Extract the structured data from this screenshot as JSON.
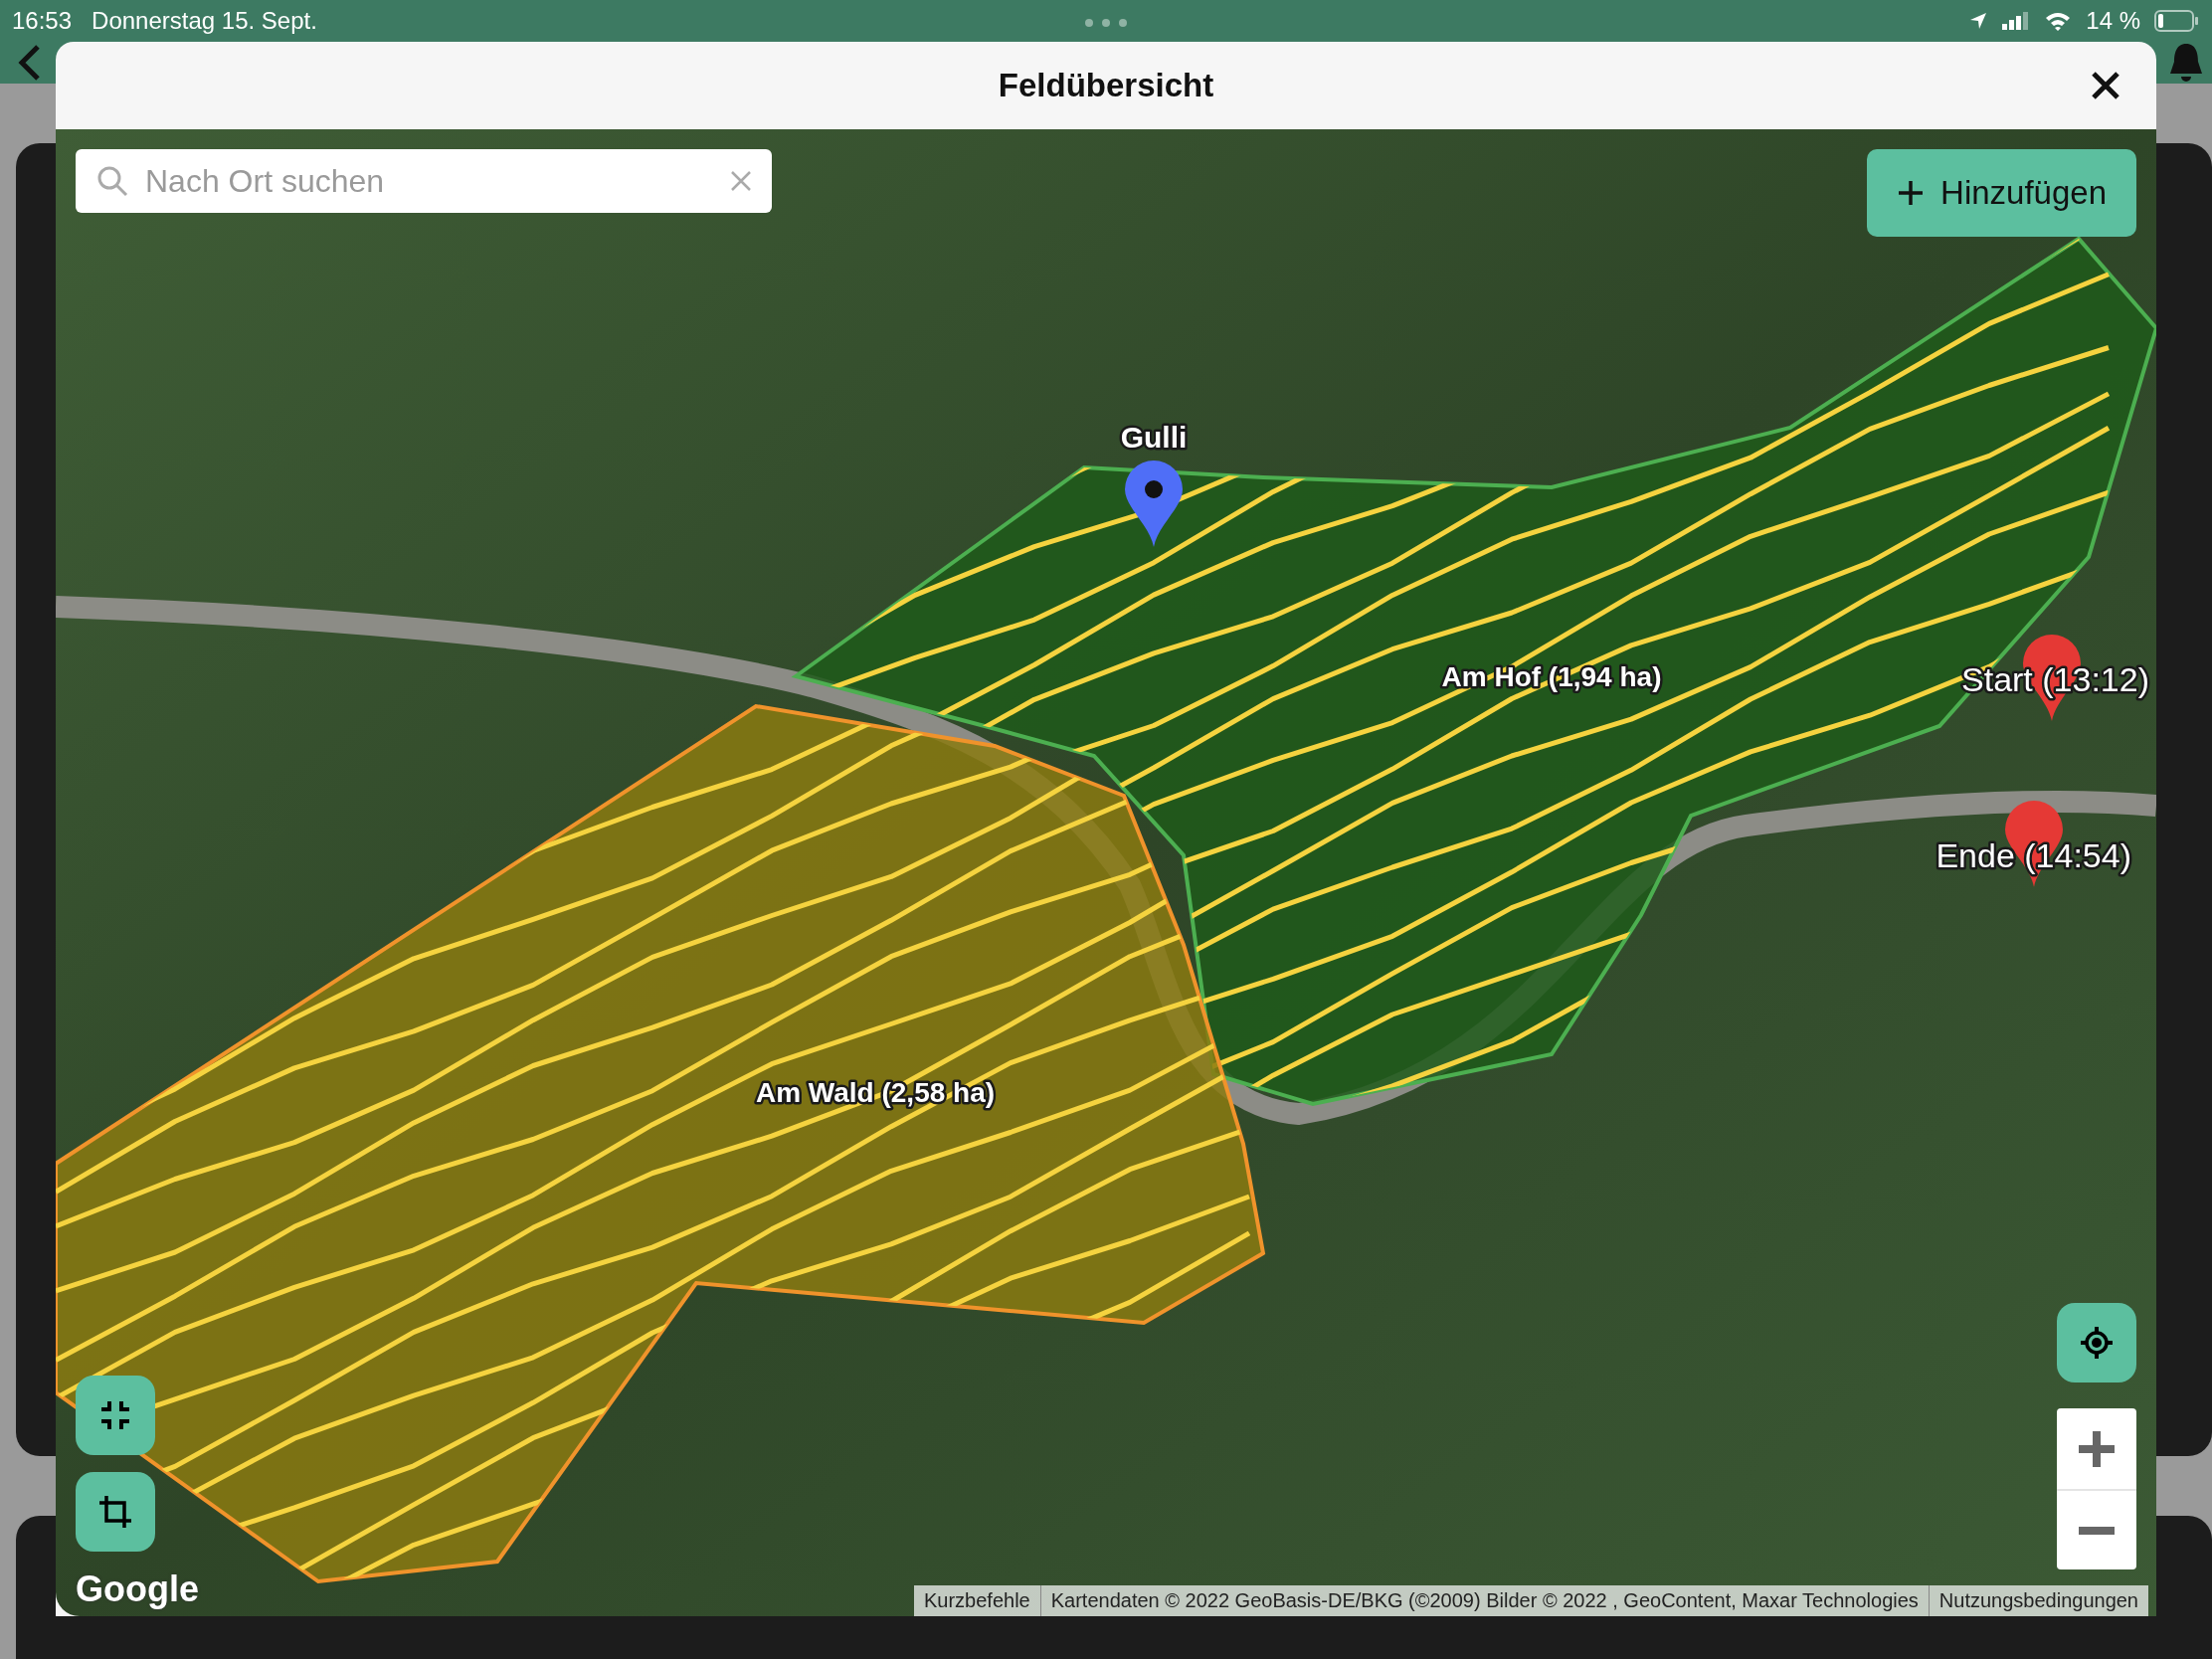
{
  "status_bar": {
    "time": "16:53",
    "date": "Donnerstag 15. Sept.",
    "battery": "14 %"
  },
  "dialog": {
    "title": "Feldübersicht"
  },
  "search": {
    "placeholder": "Nach Ort suchen"
  },
  "add_button": {
    "label": "Hinzufügen"
  },
  "fields": [
    {
      "name": "Am Hof (1,94 ha)",
      "color": "#4caf50"
    },
    {
      "name": "Am Wald (2,58 ha)",
      "color": "#f0932b"
    }
  ],
  "markers": [
    {
      "label": "Gulli",
      "kind": "poi"
    },
    {
      "label": "Start (13:12)",
      "kind": "start"
    },
    {
      "label": "Ende (14:54)",
      "kind": "end"
    }
  ],
  "map_attribution": {
    "logo": "Google",
    "links": [
      "Kurzbefehle",
      "Kartendaten © 2022 GeoBasis-DE/BKG (©2009) Bilder © 2022 , GeoContent, Maxar Technologies",
      "Nutzungsbedingungen"
    ]
  }
}
